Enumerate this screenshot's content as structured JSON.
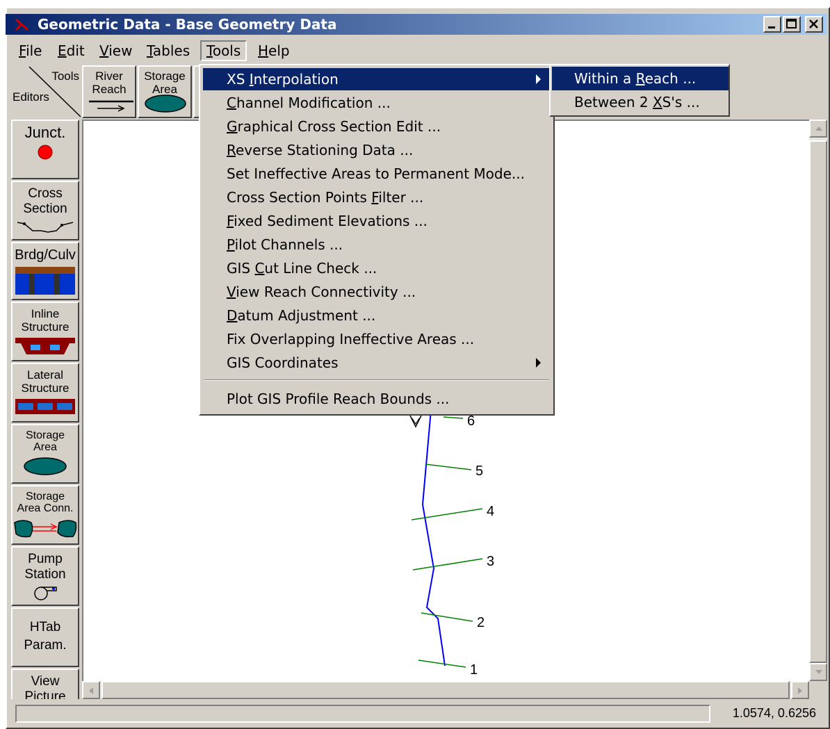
{
  "window": {
    "title": "Geometric Data - Base Geometry Data"
  },
  "menubar": {
    "file": "File",
    "edit": "Edit",
    "view": "View",
    "tables": "Tables",
    "tools": "Tools",
    "help": "Help"
  },
  "toolbar": {
    "tools_label": "Tools",
    "editors_label": "Editors",
    "river_reach": [
      "River",
      "Reach"
    ],
    "storage_area": [
      "Storage",
      "Area"
    ]
  },
  "editors": [
    {
      "line1": "Junct.",
      "line2": ""
    },
    {
      "line1": "Cross",
      "line2": "Section"
    },
    {
      "line1": "Brdg/Culv",
      "line2": ""
    },
    {
      "line1": "Inline",
      "line2": "Structure"
    },
    {
      "line1": "Lateral",
      "line2": "Structure"
    },
    {
      "line1": "Storage",
      "line2": "Area"
    },
    {
      "line1": "Storage",
      "line2": "Area Conn."
    },
    {
      "line1": "Pump",
      "line2": "Station"
    },
    {
      "line1": "HTab",
      "line2": "Param."
    },
    {
      "line1": "View",
      "line2": "Picture"
    }
  ],
  "tools_menu": {
    "items": [
      {
        "pre": "XS ",
        "key": "I",
        "post": "nterpolation",
        "submenu": true
      },
      {
        "pre": "",
        "key": "C",
        "post": "hannel Modification ...",
        "submenu": false
      },
      {
        "pre": "",
        "key": "G",
        "post": "raphical Cross Section Edit ...",
        "submenu": false
      },
      {
        "pre": "",
        "key": "R",
        "post": "everse Stationing Data ...",
        "submenu": false
      },
      {
        "pre": "Set Ineffective Areas to Permanent Mode...",
        "key": "",
        "post": "",
        "submenu": false
      },
      {
        "pre": "Cross Section Points ",
        "key": "F",
        "post": "ilter ...",
        "submenu": false
      },
      {
        "pre": "",
        "key": "F",
        "post": "ixed Sediment Elevations ...",
        "submenu": false
      },
      {
        "pre": "",
        "key": "P",
        "post": "ilot Channels ...",
        "submenu": false
      },
      {
        "pre": "GIS ",
        "key": "C",
        "post": "ut Line Check ...",
        "submenu": false
      },
      {
        "pre": "",
        "key": "V",
        "post": "iew Reach Connectivity ...",
        "submenu": false
      },
      {
        "pre": "",
        "key": "D",
        "post": "atum Adjustment ...",
        "submenu": false
      },
      {
        "pre": "Fix Overlapping Ineffective Areas ...",
        "key": "",
        "post": "",
        "submenu": false
      },
      {
        "pre": "GIS Coordinates",
        "key": "",
        "post": "",
        "submenu": true
      },
      {
        "pre": "Plot GIS Profile Reach Bounds ...",
        "key": "",
        "post": "",
        "submenu": false
      }
    ]
  },
  "submenu": {
    "items": [
      {
        "pre": "Within a ",
        "key": "R",
        "post": "each ..."
      },
      {
        "pre": "Between 2 ",
        "key": "X",
        "post": "S's ..."
      }
    ]
  },
  "cross_sections": [
    "6",
    "5",
    "4",
    "3",
    "2",
    "1"
  ],
  "status": {
    "coordinates": "1.0574, 0.6256"
  },
  "colors": {
    "title_start": "#0a246a",
    "title_end": "#a6caf0",
    "menu_highlight": "#0a246a",
    "reach_line": "#0000ff",
    "xs_line": "#008000",
    "junction": "#ff0000",
    "storage": "#006b6b"
  }
}
